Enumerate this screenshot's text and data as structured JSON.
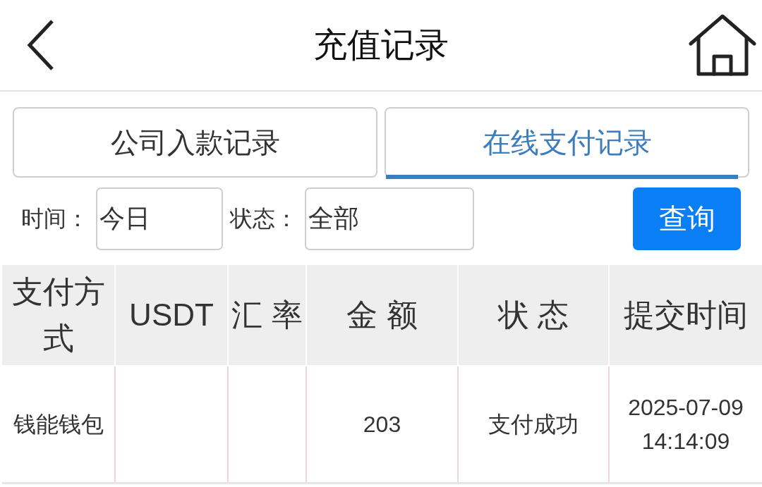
{
  "header": {
    "title": "充值记录"
  },
  "tabs": [
    {
      "label": "公司入款记录",
      "selected": false
    },
    {
      "label": "在线支付记录",
      "selected": true
    }
  ],
  "filters": [
    {
      "label": "时间：",
      "value": "今日"
    },
    {
      "label": "状态：",
      "value": "全部"
    }
  ],
  "query_button": {
    "label": "查询"
  },
  "table": {
    "columns": [
      "支付方式",
      "USDT",
      "汇 率",
      "金 额",
      "状 态",
      "提交时间"
    ],
    "rows": [
      {
        "payment_method": "钱能钱包",
        "amount": "203",
        "status": "支付成功",
        "submitted_at": "2025-07-09 14:14:09"
      }
    ]
  }
}
